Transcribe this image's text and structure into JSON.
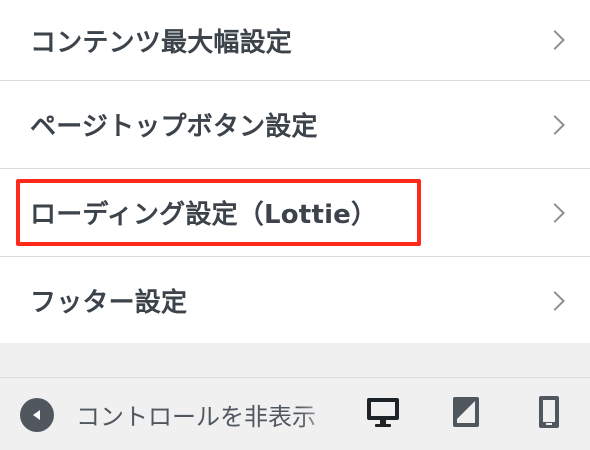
{
  "menu": {
    "items": [
      {
        "label": "コンテンツ最大幅設定"
      },
      {
        "label": "ページトップボタン設定"
      },
      {
        "label": "ローディング設定（Lottie）"
      },
      {
        "label": "フッター設定"
      }
    ]
  },
  "footer": {
    "collapse_label": "コントロールを非表示",
    "collapse_icon": "arrow-left-circle-icon",
    "devices": [
      {
        "icon": "desktop-icon",
        "active": true
      },
      {
        "icon": "tablet-icon",
        "active": false
      },
      {
        "icon": "mobile-icon",
        "active": false
      }
    ]
  },
  "colors": {
    "highlight": "#ff2a1a",
    "text": "#3c434a",
    "chevron": "#8c8f94",
    "footer_bg": "#f0f0f1"
  }
}
